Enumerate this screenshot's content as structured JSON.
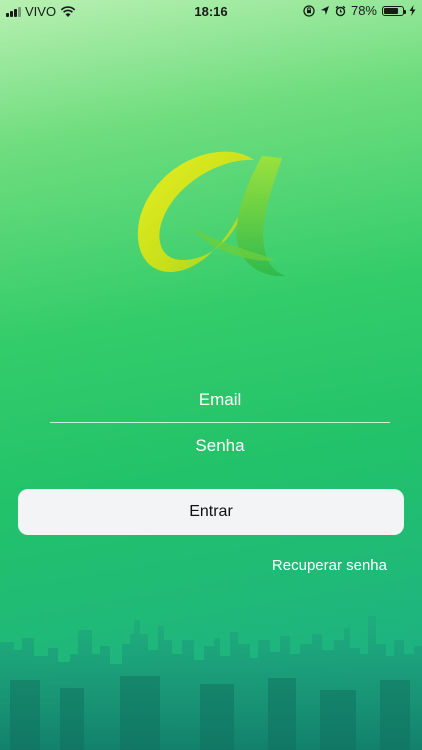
{
  "status_bar": {
    "carrier": "VIVO",
    "time": "18:16",
    "battery_percent": "78%",
    "battery_level": 0.78,
    "icons": [
      "signal-icon",
      "wifi-icon",
      "orientation-lock-icon",
      "location-icon",
      "alarm-icon",
      "battery-icon",
      "charging-icon"
    ]
  },
  "login": {
    "email_placeholder": "Email",
    "password_placeholder": "Senha",
    "submit_label": "Entrar",
    "recover_label": "Recuperar senha"
  },
  "colors": {
    "gradient_top": "#b8f0b2",
    "gradient_mid": "#33cc6a",
    "gradient_bottom": "#1aa98a",
    "button_bg": "#f2f4f6",
    "logo_yellow": "#d8e218",
    "logo_green": "#3cc24e"
  }
}
